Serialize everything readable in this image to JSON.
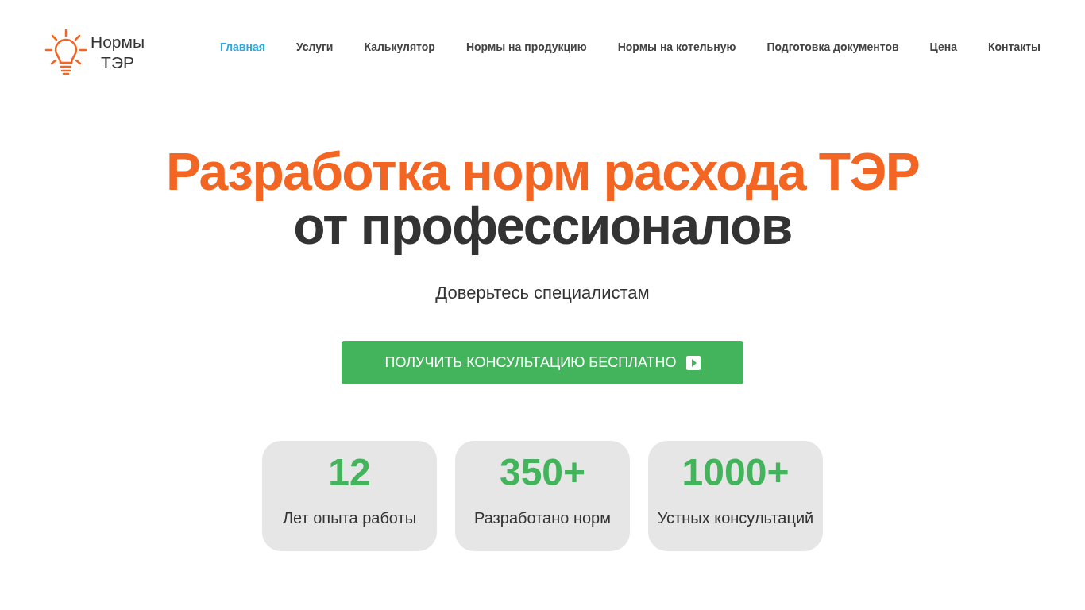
{
  "logo": {
    "line_1": "Нормы",
    "line_2": "ТЭР"
  },
  "nav": [
    {
      "label": "Главная",
      "selected": true
    },
    {
      "label": "Услуги",
      "selected": false
    },
    {
      "label": "Калькулятор",
      "selected": false
    },
    {
      "label": "Нормы на продукцию",
      "selected": false
    },
    {
      "label": "Нормы на котельную",
      "selected": false
    },
    {
      "label": "Подготовка документов",
      "selected": false
    },
    {
      "label": "Цена",
      "selected": false
    },
    {
      "label": "Контакты",
      "selected": false
    }
  ],
  "hero": {
    "title_line_1": "Разработка норм расхода ТЭР",
    "title_line_2": "от профессионалов",
    "subtitle": "Доверьтесь специалистам",
    "cta": "ПОЛУЧИТЬ КОНСУЛЬТАЦИЮ БЕСПЛАТНО"
  },
  "stats": [
    {
      "value": "12",
      "label": "Лет опыта работы"
    },
    {
      "value": "350+",
      "label": "Разработано норм"
    },
    {
      "value": "1000+",
      "label": "Устных консультаций"
    }
  ]
}
